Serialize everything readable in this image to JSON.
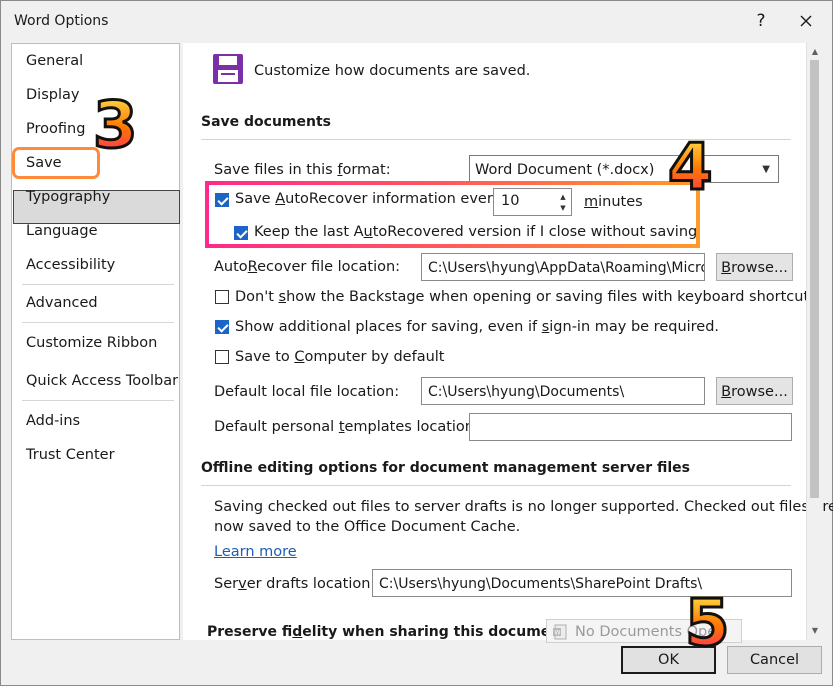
{
  "window": {
    "title": "Word Options",
    "help_glyph": "?",
    "close_glyph": "✕"
  },
  "nav": {
    "items": [
      "General",
      "Display",
      "Proofing",
      "Save",
      "Typography",
      "Language",
      "Accessibility",
      "Advanced",
      "Customize Ribbon",
      "Quick Access Toolbar",
      "Add-ins",
      "Trust Center"
    ],
    "selected": "Save"
  },
  "header": {
    "text": "Customize how documents are saved.",
    "icon": "save-floppy-icon"
  },
  "save_documents": {
    "title": "Save documents",
    "format_label_pre": "Save files in this ",
    "format_label_u": "f",
    "format_label_post": "ormat:",
    "format_value": "Word Document (*.docx)",
    "autorecover_pre": "Save ",
    "autorecover_u": "A",
    "autorecover_post": "utoRecover information every",
    "autorecover_checked": true,
    "autorecover_minutes": "10",
    "minutes_u": "m",
    "minutes_post": "inutes",
    "keep_last_pre": "Keep the last A",
    "keep_last_u": "u",
    "keep_last_post": "toRecovered version if I close without saving",
    "keep_last_checked": true,
    "autorecover_loc_pre": "Auto",
    "autorecover_loc_u": "R",
    "autorecover_loc_post": "ecover file location:",
    "autorecover_loc_value": "C:\\Users\\hyung\\AppData\\Roaming\\Microsoft\\Word\\",
    "browse_pre": "",
    "browse_u": "B",
    "browse_post": "rowse...",
    "backstage_pre": "Don't ",
    "backstage_u": "s",
    "backstage_post": "how the Backstage when opening or saving files with keyboard shortcuts",
    "backstage_checked": false,
    "additional_pre": "Show additional places for saving, even if ",
    "additional_u": "s",
    "additional_post": "ign-in may be required.",
    "additional_checked": true,
    "computer_pre": "Save to ",
    "computer_u": "C",
    "computer_post": "omputer by default",
    "computer_checked": false,
    "local_loc_pre": "Default local f",
    "local_loc_u": "i",
    "local_loc_post": "le location:",
    "local_loc_value": "C:\\Users\\hyung\\Documents\\",
    "templates_pre": "Default personal ",
    "templates_u": "t",
    "templates_post": "emplates location:",
    "templates_value": ""
  },
  "offline": {
    "title": "Offline editing options for document management server files",
    "note_line1": "Saving checked out files to server drafts is no longer supported. Checked out files are",
    "note_line2": "now saved to the Office Document Cache.",
    "learn_more": "Learn more",
    "server_pre": "Ser",
    "server_u": "v",
    "server_post": "er drafts location:",
    "server_value": "C:\\Users\\hyung\\Documents\\SharePoint Drafts\\"
  },
  "fidelity": {
    "title_pre": "Preserve fi",
    "title_u": "d",
    "title_post": "elity when sharing this document:",
    "doc_value": "No Documents Open"
  },
  "footer": {
    "ok": "OK",
    "cancel": "Cancel"
  },
  "annotations": {
    "step3": "3",
    "step4": "4",
    "step5": "5"
  },
  "colors": {
    "accent": "#1c65c8",
    "link": "#1a5fb4",
    "annotation_orange": "#ff8a3a",
    "annotation_pink": "#ff2a8a",
    "save_icon": "#7b2fa8"
  }
}
